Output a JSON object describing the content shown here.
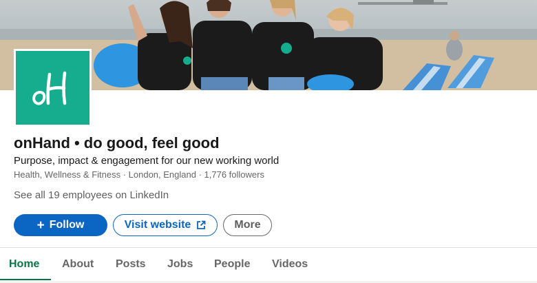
{
  "company": {
    "logo_text": "oH",
    "name": "onHand • do good, feel good",
    "tagline": "Purpose, impact & engagement for our new working world",
    "meta": "Health, Wellness & Fitness · London, England · 1,776 followers",
    "employees_link": "See all 19 employees on LinkedIn"
  },
  "actions": {
    "follow_label": "Follow",
    "visit_label": "Visit website",
    "more_label": "More"
  },
  "tabs": [
    {
      "label": "Home",
      "active": true
    },
    {
      "label": "About"
    },
    {
      "label": "Posts"
    },
    {
      "label": "Jobs"
    },
    {
      "label": "People"
    },
    {
      "label": "Videos"
    }
  ],
  "colors": {
    "brand_teal": "#16ad8f",
    "linkedin_blue": "#0a66c2",
    "active_tab_green": "#057642"
  }
}
